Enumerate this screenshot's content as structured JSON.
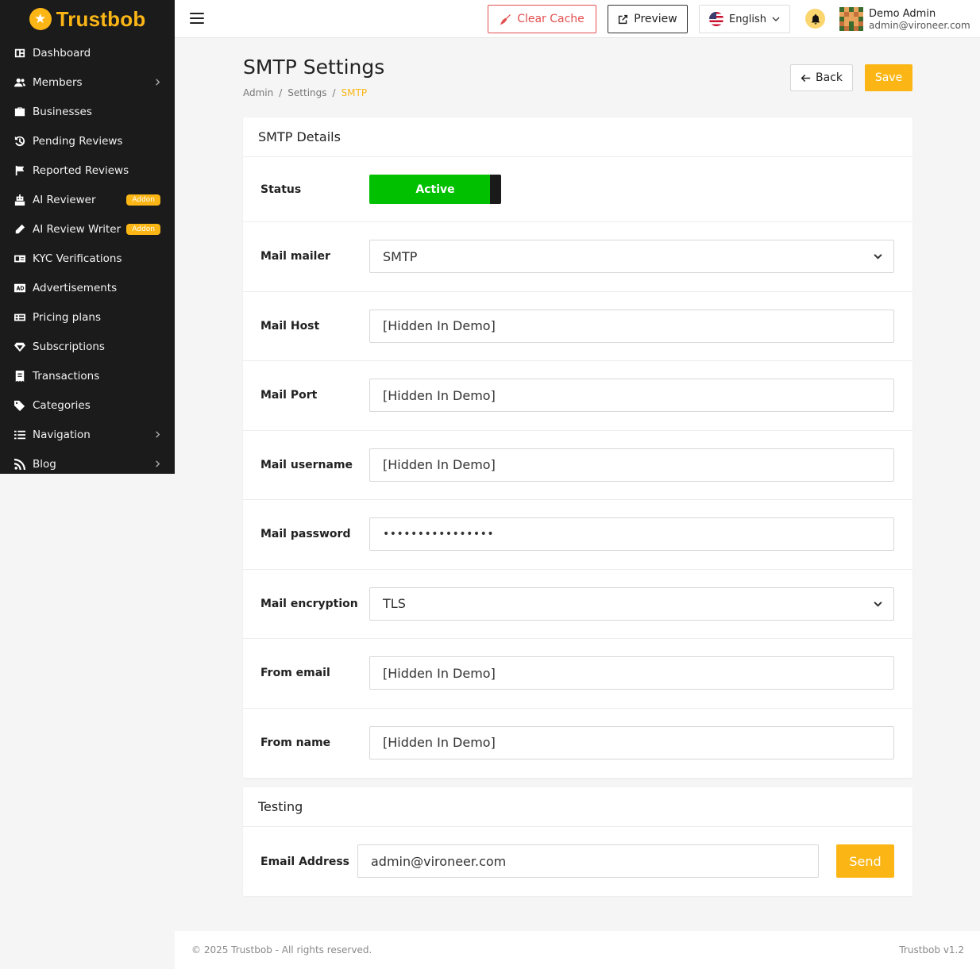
{
  "brand": {
    "name": "Trustbob",
    "accent": "#fbb616"
  },
  "sidebar": {
    "items": [
      {
        "label": "Dashboard",
        "icon": "dashboard-icon"
      },
      {
        "label": "Members",
        "icon": "users-icon"
      },
      {
        "label": "Businesses",
        "icon": "briefcase-icon"
      },
      {
        "label": "Pending Reviews",
        "icon": "history-icon"
      },
      {
        "label": "Reported Reviews",
        "icon": "flag-icon"
      },
      {
        "label": "AI Reviewer",
        "icon": "robot-icon",
        "badge": "Addon"
      },
      {
        "label": "AI Review Writer",
        "icon": "pen-icon",
        "badge": "Addon"
      },
      {
        "label": "KYC Verifications",
        "icon": "id-card-icon"
      },
      {
        "label": "Advertisements",
        "icon": "ad-icon"
      },
      {
        "label": "Pricing plans",
        "icon": "pricing-icon"
      },
      {
        "label": "Subscriptions",
        "icon": "gem-icon"
      },
      {
        "label": "Transactions",
        "icon": "receipt-icon"
      },
      {
        "label": "Categories",
        "icon": "tags-icon"
      },
      {
        "label": "Navigation",
        "icon": "list-icon"
      },
      {
        "label": "Blog",
        "icon": "rss-icon"
      }
    ]
  },
  "topbar": {
    "clear_cache": "Clear Cache",
    "preview": "Preview",
    "language": "English",
    "user_name": "Demo Admin",
    "user_email": "admin@vironeer.com"
  },
  "page": {
    "title": "SMTP Settings",
    "breadcrumb": [
      "Admin",
      "/",
      "Settings",
      "/",
      "SMTP"
    ],
    "back": "Back",
    "save": "Save"
  },
  "smtp": {
    "title": "SMTP Details",
    "status_label": "Status",
    "status_value": "Active",
    "status_color": "#00c000",
    "mailer_label": "Mail mailer",
    "mailer_value": "SMTP",
    "host_label": "Mail Host",
    "host_value": "[Hidden In Demo]",
    "port_label": "Mail Port",
    "port_value": "[Hidden In Demo]",
    "username_label": "Mail username",
    "username_value": "[Hidden In Demo]",
    "password_label": "Mail password",
    "password_value": "••••••••••••••••",
    "encryption_label": "Mail encryption",
    "encryption_value": "TLS",
    "from_email_label": "From email",
    "from_email_value": "[Hidden In Demo]",
    "from_name_label": "From name",
    "from_name_value": "[Hidden In Demo]"
  },
  "testing": {
    "title": "Testing",
    "email_label": "Email Address",
    "email_value": "admin@vironeer.com",
    "send": "Send"
  },
  "footer": {
    "copyright": "© 2025 Trustbob - All rights reserved.",
    "version": "Trustbob v1.2"
  }
}
